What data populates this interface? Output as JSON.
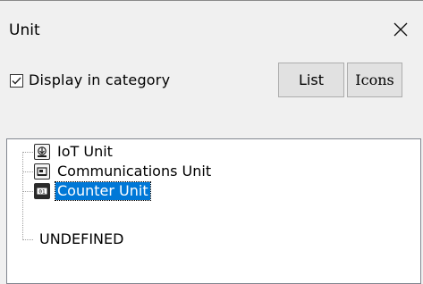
{
  "window": {
    "title": "Unit"
  },
  "options": {
    "display_in_category_label": "Display in category",
    "display_in_category_checked": true
  },
  "buttons": {
    "list_label": "List",
    "icons_label": "Icons"
  },
  "tree": {
    "items": [
      {
        "label": "IoT Unit",
        "icon": "iot-unit-icon",
        "selected": false
      },
      {
        "label": "Communications Unit",
        "icon": "communications-unit-icon",
        "selected": false
      },
      {
        "label": "Counter Unit",
        "icon": "counter-unit-icon",
        "selected": true
      },
      {
        "label": "UNDEFINED",
        "icon": "",
        "selected": false
      }
    ]
  },
  "colors": {
    "selection": "#0078d7",
    "background": "#f0f0f0",
    "panel": "#ffffff"
  }
}
